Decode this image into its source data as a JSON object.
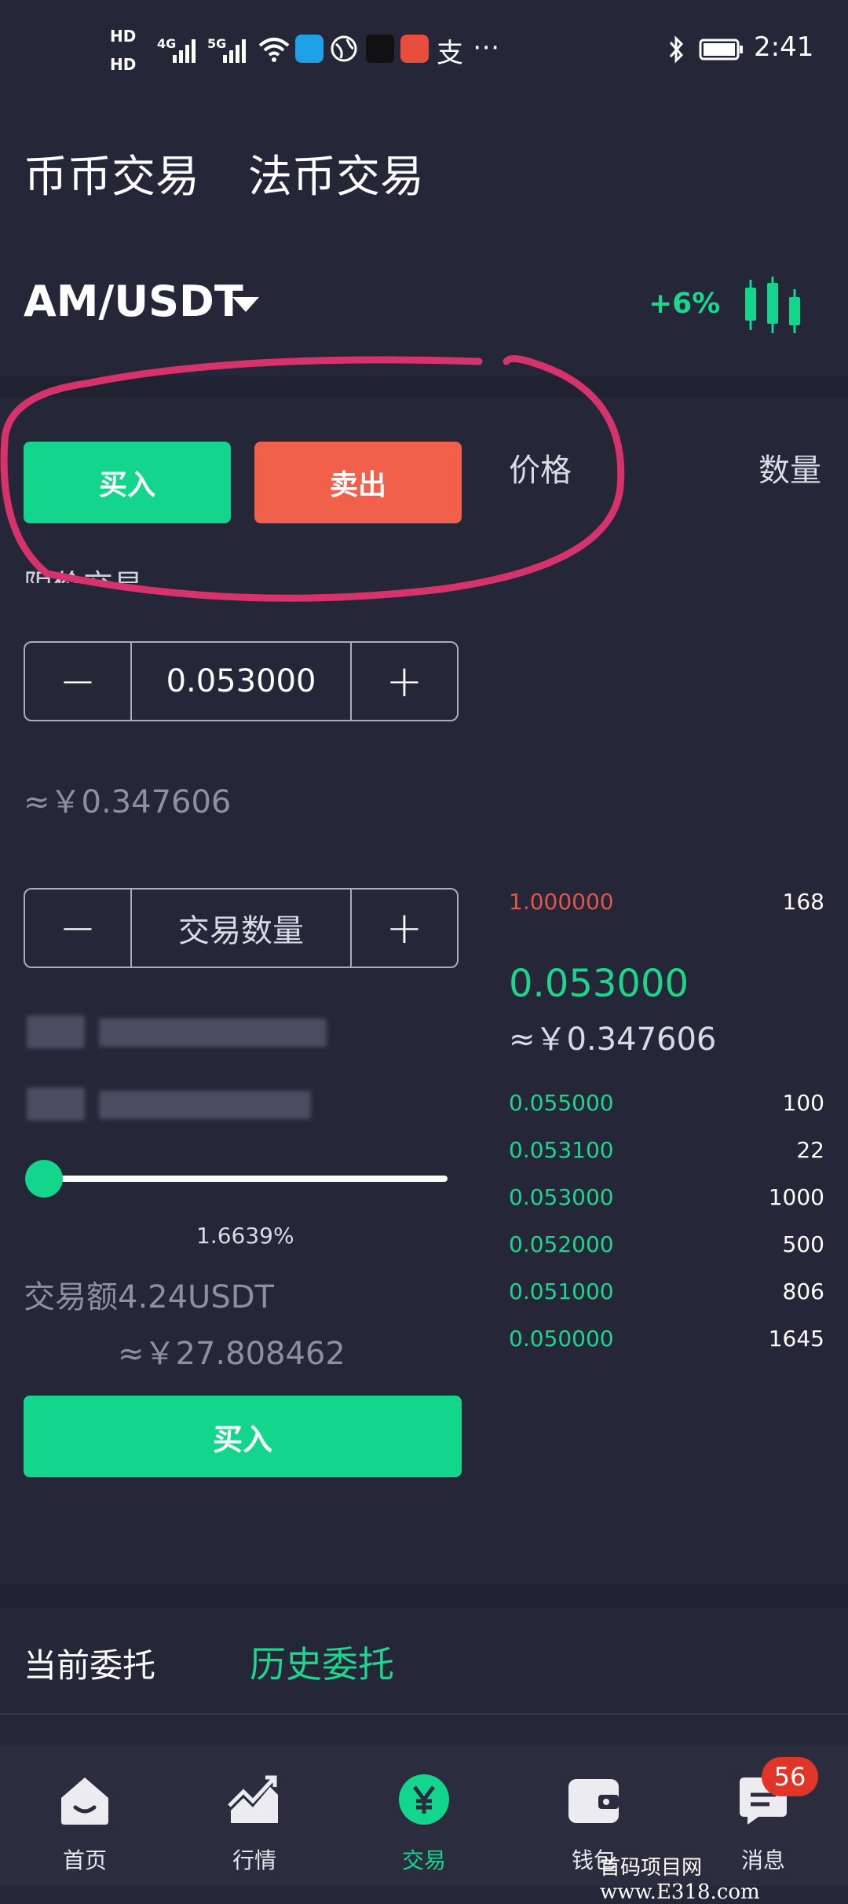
{
  "status_bar": {
    "hd1": "HD",
    "hd2": "HD",
    "net1": "4G",
    "net2": "5G",
    "more": "⋯",
    "zhi": "支",
    "time": "2:41"
  },
  "header": {
    "tabs": [
      "币币交易",
      "法币交易"
    ]
  },
  "pair": {
    "name": "AM/USDT",
    "change": "+6%"
  },
  "trade_form": {
    "buy_tab_label": "买入",
    "sell_tab_label": "卖出",
    "order_type": "限价交易",
    "price_value": "0.053000",
    "price_approx": "≈￥0.347606",
    "quantity_placeholder": "交易数量",
    "minus_symbol": "−",
    "plus_symbol": "+",
    "percent": "1.6639%",
    "trade_amount": "交易额4.24USDT",
    "amount_approx": "≈￥27.808462",
    "submit_label": "买入"
  },
  "order_book": {
    "price_header": "价格",
    "quantity_header": "数量",
    "asks": [
      {
        "price": "1.000000",
        "qty": "168"
      }
    ],
    "last_price": "0.053000",
    "last_price_approx": "≈￥0.347606",
    "bids": [
      {
        "price": "0.055000",
        "qty": "100"
      },
      {
        "price": "0.053100",
        "qty": "22"
      },
      {
        "price": "0.053000",
        "qty": "1000"
      },
      {
        "price": "0.052000",
        "qty": "500"
      },
      {
        "price": "0.051000",
        "qty": "806"
      },
      {
        "price": "0.050000",
        "qty": "1645"
      }
    ]
  },
  "orders": {
    "current_label": "当前委托",
    "history_label": "历史委托"
  },
  "bottom_nav": {
    "items": [
      {
        "label": "首页",
        "icon": "home-icon"
      },
      {
        "label": "行情",
        "icon": "chart-icon"
      },
      {
        "label": "交易",
        "icon": "yen-icon"
      },
      {
        "label": "钱包",
        "icon": "wallet-icon"
      },
      {
        "label": "消息",
        "icon": "message-icon"
      }
    ],
    "message_badge": "56"
  },
  "watermark": "首码项目网  www.E318.com",
  "colors": {
    "background": "#252738",
    "buy_green": "#13d68c",
    "sell_red": "#f1604a",
    "highlight_pink": "#d6336c"
  }
}
